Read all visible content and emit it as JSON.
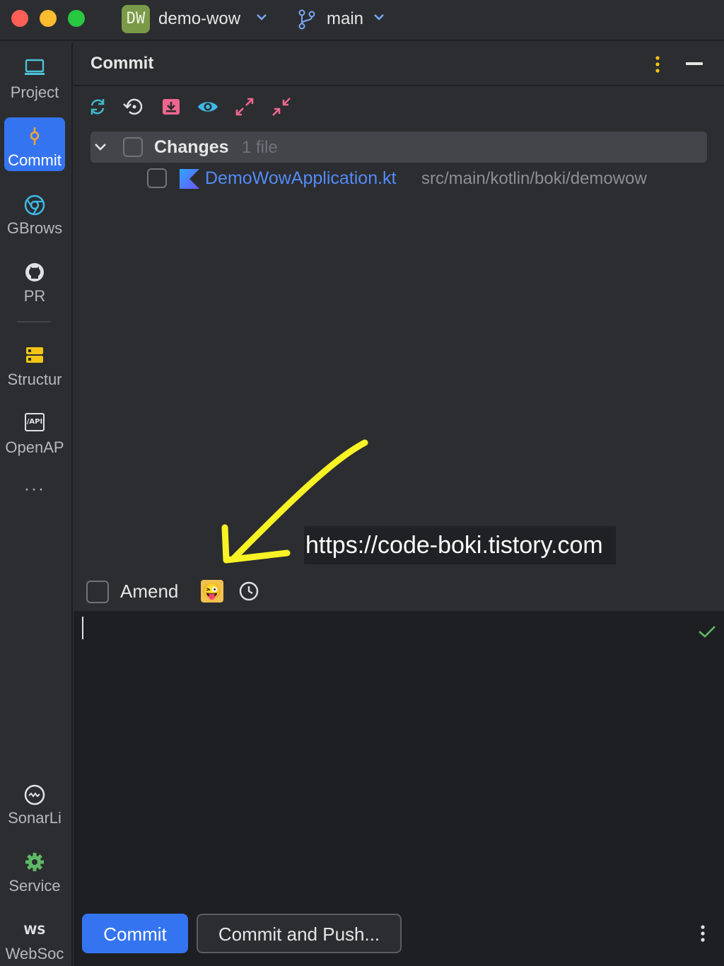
{
  "titlebar": {
    "project_badge": "DW",
    "project_name": "demo-wow",
    "branch": "main"
  },
  "sidebar": {
    "items": [
      {
        "label": "Project",
        "icon": "monitor-icon"
      },
      {
        "label": "Commit",
        "icon": "commit-icon",
        "active": true
      },
      {
        "label": "GBrows",
        "icon": "browser-icon"
      },
      {
        "label": "PR",
        "icon": "github-icon"
      },
      {
        "label": "Structur",
        "icon": "structure-icon"
      },
      {
        "label": "OpenAP",
        "icon": "api-icon",
        "icon_text": "/API"
      },
      {
        "label": "SonarLi",
        "icon": "sonar-icon"
      },
      {
        "label": "Service",
        "icon": "gear-icon"
      },
      {
        "label": "WebSoc",
        "icon": "websocket-icon",
        "icon_text": "WS"
      }
    ],
    "more": "···"
  },
  "panel": {
    "title": "Commit"
  },
  "toolbar": {
    "buttons": [
      "refresh-icon",
      "rollback-icon",
      "shelve-icon",
      "preview-icon",
      "expand-all-icon",
      "collapse-all-icon"
    ]
  },
  "changes": {
    "label": "Changes",
    "count": "1 file",
    "files": [
      {
        "name": "DemoWowApplication.kt",
        "path": "src/main/kotlin/boki/demowow"
      }
    ]
  },
  "watermark": "https://code-boki.tistory.com",
  "amend": {
    "label": "Amend",
    "emoji": "😜"
  },
  "message": {
    "value": ""
  },
  "actions": {
    "commit": "Commit",
    "commit_and_push": "Commit and Push..."
  },
  "colors": {
    "accent": "#3574f0",
    "file_link": "#548af7",
    "annotation_arrow": "#f7f325"
  }
}
